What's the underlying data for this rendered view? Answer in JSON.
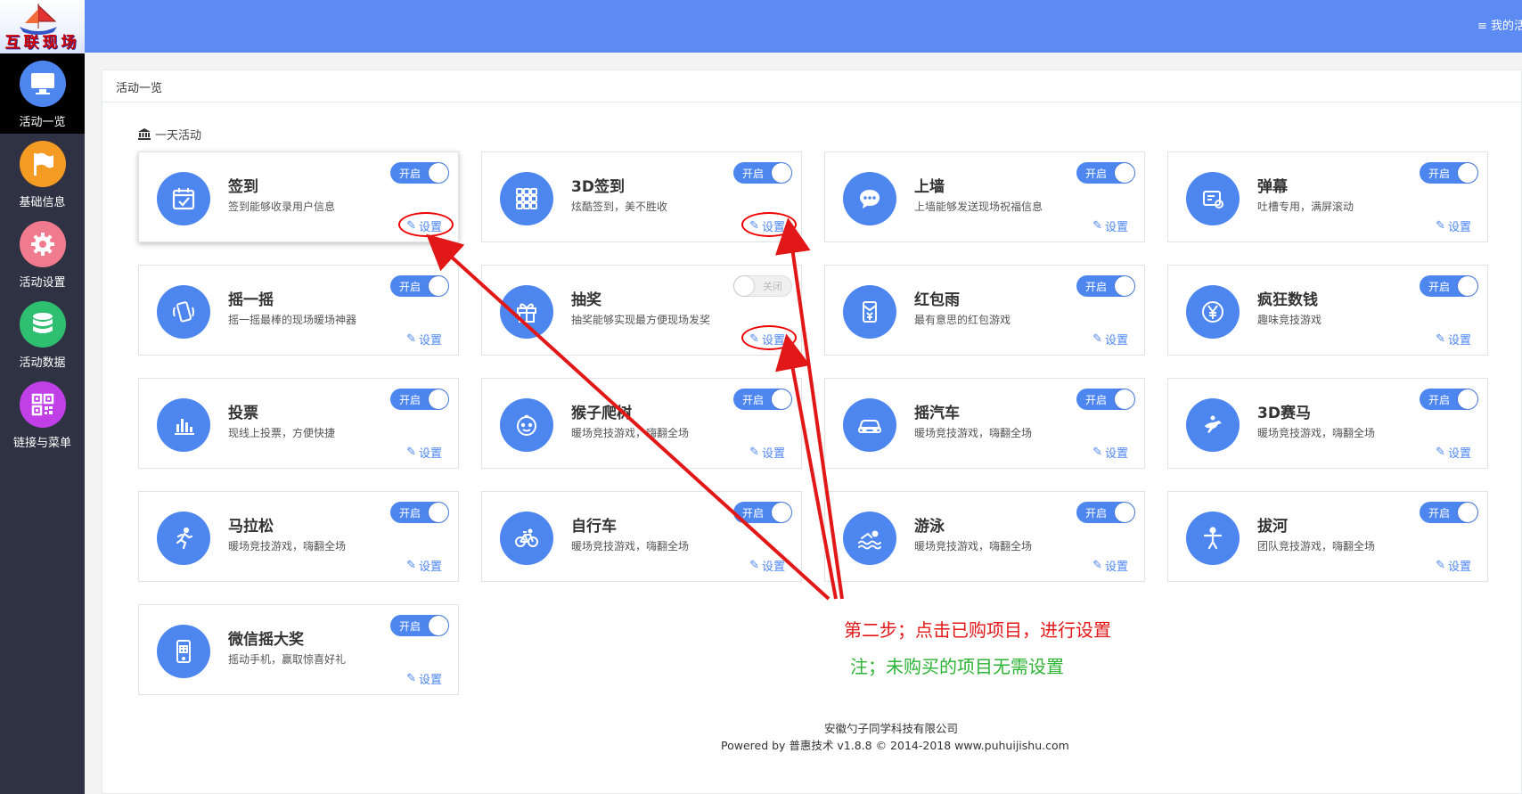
{
  "brand": {
    "logo_text": "互联现场"
  },
  "sidebar": {
    "items": [
      {
        "label": "活动一览",
        "icon": "monitor-icon",
        "color": "#4e86f0",
        "active": true
      },
      {
        "label": "基础信息",
        "icon": "flag-icon",
        "color": "#f59a23",
        "active": false
      },
      {
        "label": "活动设置",
        "icon": "gear-icon",
        "color": "#f07b8e",
        "active": false
      },
      {
        "label": "活动数据",
        "icon": "database-icon",
        "color": "#2fbf71",
        "active": false
      },
      {
        "label": "链接与菜单",
        "icon": "qrcode-icon",
        "color": "#c13fe6",
        "active": false
      }
    ]
  },
  "topbar": {
    "menu_label": "≡ 我的活"
  },
  "panel": {
    "breadcrumb": "活动一览",
    "section_title": "一天活动"
  },
  "cards": [
    {
      "title": "签到",
      "desc": "签到能够收录用户信息",
      "toggle": "开启",
      "on": true,
      "setting": "设置",
      "icon": "calendar-check-icon"
    },
    {
      "title": "3D签到",
      "desc": "炫酷签到，美不胜收",
      "toggle": "开启",
      "on": true,
      "setting": "设置",
      "icon": "grid-icon"
    },
    {
      "title": "上墙",
      "desc": "上墙能够发送现场祝福信息",
      "toggle": "开启",
      "on": true,
      "setting": "设置",
      "icon": "chat-bubble-icon"
    },
    {
      "title": "弹幕",
      "desc": "吐槽专用，满屏滚动",
      "toggle": "开启",
      "on": true,
      "setting": "设置",
      "icon": "barrage-icon"
    },
    {
      "title": "摇一摇",
      "desc": "摇一摇最棒的现场暖场神器",
      "toggle": "开启",
      "on": true,
      "setting": "设置",
      "icon": "shake-phone-icon"
    },
    {
      "title": "抽奖",
      "desc": "抽奖能够实现最方便现场发奖",
      "toggle": "关闭",
      "on": false,
      "setting": "设置",
      "icon": "gift-icon"
    },
    {
      "title": "红包雨",
      "desc": "最有意思的红包游戏",
      "toggle": "开启",
      "on": true,
      "setting": "设置",
      "icon": "red-envelope-icon"
    },
    {
      "title": "疯狂数钱",
      "desc": "趣味竞技游戏",
      "toggle": "开启",
      "on": true,
      "setting": "设置",
      "icon": "yen-coin-icon"
    },
    {
      "title": "投票",
      "desc": "现线上投票，方便快捷",
      "toggle": "开启",
      "on": true,
      "setting": "设置",
      "icon": "bar-chart-icon"
    },
    {
      "title": "猴子爬树",
      "desc": "暖场竞技游戏，嗨翻全场",
      "toggle": "开启",
      "on": true,
      "setting": "设置",
      "icon": "monkey-icon"
    },
    {
      "title": "摇汽车",
      "desc": "暖场竞技游戏，嗨翻全场",
      "toggle": "开启",
      "on": true,
      "setting": "设置",
      "icon": "car-icon"
    },
    {
      "title": "3D赛马",
      "desc": "暖场竞技游戏，嗨翻全场",
      "toggle": "开启",
      "on": true,
      "setting": "设置",
      "icon": "horse-racing-icon"
    },
    {
      "title": "马拉松",
      "desc": "暖场竞技游戏，嗨翻全场",
      "toggle": "开启",
      "on": true,
      "setting": "设置",
      "icon": "runner-icon"
    },
    {
      "title": "自行车",
      "desc": "暖场竞技游戏，嗨翻全场",
      "toggle": "开启",
      "on": true,
      "setting": "设置",
      "icon": "bicycle-icon"
    },
    {
      "title": "游泳",
      "desc": "暖场竞技游戏，嗨翻全场",
      "toggle": "开启",
      "on": true,
      "setting": "设置",
      "icon": "swimmer-icon"
    },
    {
      "title": "拔河",
      "desc": "团队竞技游戏，嗨翻全场",
      "toggle": "开启",
      "on": true,
      "setting": "设置",
      "icon": "tug-of-war-icon"
    },
    {
      "title": "微信摇大奖",
      "desc": "摇动手机，赢取惊喜好礼",
      "toggle": "开启",
      "on": true,
      "setting": "设置",
      "icon": "phone-prize-icon"
    }
  ],
  "footer": {
    "company": "安徽勺子同学科技有限公司",
    "powered": "Powered by 普惠技术 v1.8.8 © 2014-2018 www.puhuijishu.com"
  },
  "annotations": {
    "step": "第二步；点击已购项目，进行设置",
    "note": "注；未购买的项目无需设置"
  },
  "colors": {
    "accent": "#4e86f0",
    "topbar": "#5b8bf3",
    "sidebar": "#2f3242",
    "annotation_red": "#e21818",
    "annotation_green": "#2db436"
  }
}
